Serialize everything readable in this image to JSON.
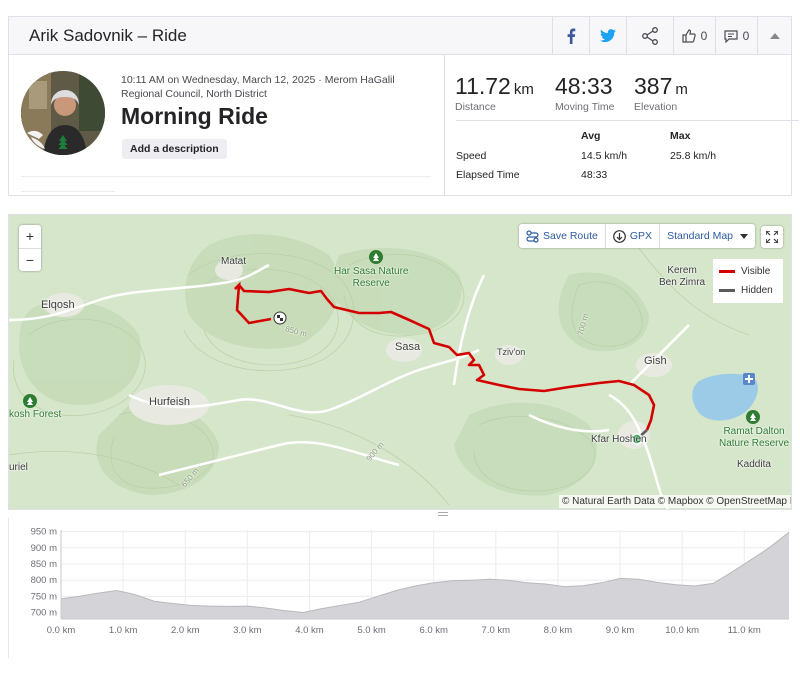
{
  "header": {
    "title": "Arik Sadovnik – Ride",
    "kudos_count": "0",
    "comments_count": "0"
  },
  "activity": {
    "meta_text": "10:11 AM on Wednesday, March 12, 2025 · Merom HaGalil Regional Council, North District",
    "name": "Morning Ride",
    "add_description_label": "Add a description"
  },
  "stats": {
    "distance": {
      "value": "11.72",
      "unit": "km",
      "label": "Distance"
    },
    "moving_time": {
      "value": "48:33",
      "label": "Moving Time"
    },
    "elevation": {
      "value": "387",
      "unit": "m",
      "label": "Elevation"
    },
    "table": {
      "headers": [
        "Avg",
        "Max"
      ],
      "rows": [
        {
          "label": "Speed",
          "avg": "14.5 km/h",
          "max": "25.8 km/h"
        },
        {
          "label": "Elapsed Time",
          "avg": "48:33",
          "max": ""
        }
      ]
    }
  },
  "map": {
    "zoom_in": "+",
    "zoom_out": "−",
    "save_route_label": "Save Route",
    "gpx_label": "GPX",
    "map_style_label": "Standard Map",
    "legend": {
      "visible": "Visible",
      "hidden": "Hidden"
    },
    "attribution": "© Natural Earth Data © Mapbox © OpenStreetMap I",
    "places": {
      "matat": "Matat",
      "elqosh": "Elqosh",
      "sasa": "Sasa",
      "tzivon": "Tziv'on",
      "gish": "Gish",
      "kerem_ben_zimra": "Kerem\nBen Zimra",
      "hurfeish": "Hurfeish",
      "kfar_hoshen": "Kfar Hoshen",
      "kaddita": "Kaddita",
      "kosh_forest": "kosh Forest",
      "uriel": "uriel",
      "har_sasa": "Har Sasa Nature\nReserve",
      "ramat_dalton": "Ramat Dalton\nNature Reserve",
      "contour_850": "850 m",
      "contour_700": "700 m",
      "contour_900": "900 m",
      "contour_650": "650 m"
    },
    "colors": {
      "route_visible": "#d40000",
      "route_hidden": "#5c5c5c",
      "park": "#2e7d32"
    }
  },
  "chart_data": {
    "type": "area",
    "xlabel": "",
    "ylabel": "",
    "x_ticks": [
      "0.0 km",
      "1.0 km",
      "2.0 km",
      "3.0 km",
      "4.0 km",
      "5.0 km",
      "6.0 km",
      "7.0 km",
      "8.0 km",
      "9.0 km",
      "10.0 km",
      "11.0 km"
    ],
    "y_ticks": [
      "950 m",
      "900 m",
      "850 m",
      "800 m",
      "750 m",
      "700 m"
    ],
    "xlim": [
      0,
      11.72
    ],
    "ylim": [
      680,
      955
    ],
    "x": [
      0,
      0.3,
      0.6,
      0.9,
      1.2,
      1.5,
      1.8,
      2.1,
      2.4,
      2.7,
      3.0,
      3.3,
      3.6,
      3.9,
      4.2,
      4.5,
      4.8,
      5.1,
      5.4,
      5.7,
      6.0,
      6.3,
      6.6,
      6.9,
      7.2,
      7.5,
      7.8,
      8.1,
      8.4,
      8.7,
      9.0,
      9.3,
      9.6,
      9.9,
      10.2,
      10.5,
      10.8,
      11.1,
      11.4,
      11.72
    ],
    "y": [
      742,
      750,
      760,
      768,
      755,
      735,
      728,
      722,
      720,
      719,
      720,
      714,
      706,
      700,
      712,
      722,
      732,
      750,
      768,
      782,
      792,
      798,
      800,
      803,
      800,
      792,
      788,
      780,
      783,
      792,
      805,
      803,
      793,
      786,
      782,
      790,
      825,
      862,
      900,
      948
    ]
  }
}
